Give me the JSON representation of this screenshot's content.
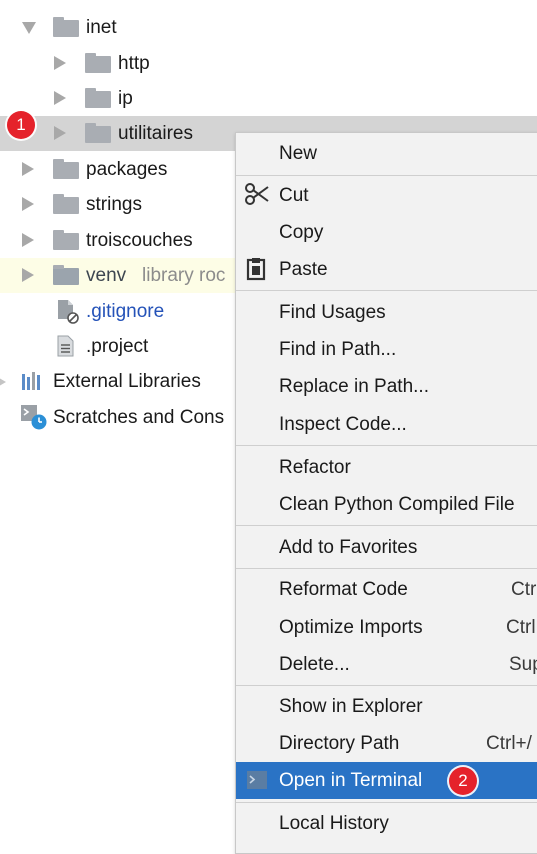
{
  "tree": {
    "items": [
      {
        "label": "inet"
      },
      {
        "label": "http"
      },
      {
        "label": "ip"
      },
      {
        "label": "utilitaires"
      },
      {
        "label": "packages"
      },
      {
        "label": "strings"
      },
      {
        "label": "troiscouches"
      },
      {
        "label": "venv",
        "note": "library roc"
      },
      {
        "label": ".gitignore"
      },
      {
        "label": ".project"
      },
      {
        "label": "External Libraries"
      },
      {
        "label": "Scratches and Cons"
      }
    ],
    "badge1": "1"
  },
  "menu": {
    "items": [
      {
        "label": "New"
      },
      {
        "label": "Cut"
      },
      {
        "label": "Copy"
      },
      {
        "label": "Paste"
      },
      {
        "label": "Find Usages"
      },
      {
        "label": "Find in Path..."
      },
      {
        "label": "Replace in Path..."
      },
      {
        "label": "Inspect Code..."
      },
      {
        "label": "Refactor"
      },
      {
        "label": "Clean Python Compiled File"
      },
      {
        "label": "Add to Favorites"
      },
      {
        "label": "Reformat Code",
        "shortcut": "Ctr"
      },
      {
        "label": "Optimize Imports",
        "shortcut": "Ctrl"
      },
      {
        "label": "Delete...",
        "shortcut": "Sup"
      },
      {
        "label": "Show in Explorer"
      },
      {
        "label": "Directory Path",
        "shortcut": "Ctrl+/"
      },
      {
        "label": "Open in Terminal"
      },
      {
        "label": "Local History"
      }
    ],
    "badge2": "2"
  },
  "colors": {
    "highlight": "#2a73c5",
    "badge": "#e5222b",
    "selection": "#d4d4d4"
  }
}
